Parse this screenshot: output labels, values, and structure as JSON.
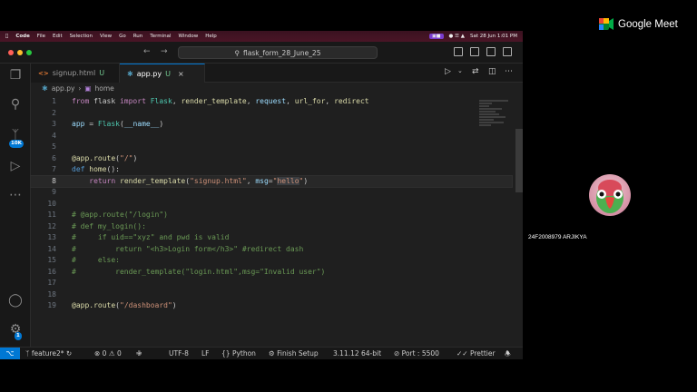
{
  "menubar": {
    "app": "Code",
    "items": [
      "File",
      "Edit",
      "Selection",
      "View",
      "Go",
      "Run",
      "Terminal",
      "Window",
      "Help"
    ],
    "datetime": "Sat 28 Jun  1:01 PM"
  },
  "titlebar": {
    "search_text": "flask_form_28_June_25"
  },
  "activity": {
    "source_control_badge": "10K",
    "settings_badge": "1"
  },
  "tabs": [
    {
      "label": "signup.html",
      "status": "U"
    },
    {
      "label": "app.py",
      "status": "U"
    }
  ],
  "breadcrumb": {
    "file": "app.py",
    "symbol": "home"
  },
  "editor": {
    "lines": [
      {
        "n": "1",
        "text": "from flask import Flask, render_template, request, url_for, redirect"
      },
      {
        "n": "2",
        "text": ""
      },
      {
        "n": "3",
        "text": "app = Flask(__name__)"
      },
      {
        "n": "4",
        "text": ""
      },
      {
        "n": "5",
        "text": ""
      },
      {
        "n": "6",
        "text": "@app.route(\"/\")"
      },
      {
        "n": "7",
        "text": "def home():"
      },
      {
        "n": "8",
        "text": "    return render_template(\"signup.html\", msg=\"hello\")"
      },
      {
        "n": "9",
        "text": ""
      },
      {
        "n": "10",
        "text": ""
      },
      {
        "n": "11",
        "text": "# @app.route(\"/login\")"
      },
      {
        "n": "12",
        "text": "# def my_login():"
      },
      {
        "n": "13",
        "text": "#     if uid==\"xyz\" and pwd is valid"
      },
      {
        "n": "14",
        "text": "#         return \"<h3>Login form</h3>\" #redirect dash"
      },
      {
        "n": "15",
        "text": "#     else:"
      },
      {
        "n": "16",
        "text": "#         render_template(\"login.html\",msg=\"Invalid user\")"
      },
      {
        "n": "17",
        "text": ""
      },
      {
        "n": "18",
        "text": ""
      },
      {
        "n": "19",
        "text": "@app.route(\"/dashboard\")"
      }
    ]
  },
  "statusbar": {
    "branch": "feature2*",
    "problems": "0",
    "warnings": "0",
    "encoding": "UTF-8",
    "eol": "LF",
    "language": "Python",
    "finish_setup": "Finish Setup",
    "interpreter": "3.11.12 64-bit",
    "port": "Port : 5500",
    "prettier": "Prettier"
  },
  "dock": {
    "calendar_day": "28"
  },
  "meet": {
    "title": "Google Meet",
    "participant_name": "24F2008979 ARJIKYA"
  },
  "colors": {
    "accent": "#0078d4",
    "editor_bg": "#1f1f1f",
    "keyword": "#c586c0",
    "string": "#ce9178",
    "comment": "#6a9955"
  }
}
